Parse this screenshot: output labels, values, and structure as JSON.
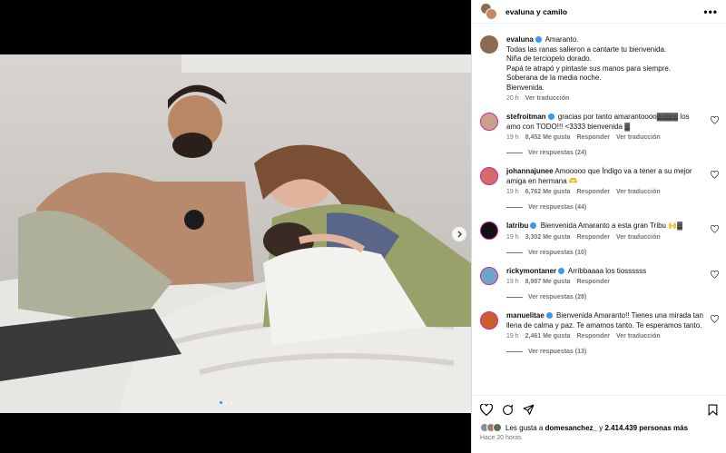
{
  "post": {
    "author": "evaluna y camilo",
    "more_label": "•••"
  },
  "caption": {
    "username": "evaluna",
    "lines": [
      "Amaranto.",
      "Todas las ranas salieron a cantarte tu bienvenida.",
      "Niña de terciopelo dorado.",
      "Papá te atrapó y pintaste sus manos para siempre.",
      "Soberana de la media noche.",
      "Bienvenida."
    ],
    "time": "20 h",
    "translate": "Ver traducción"
  },
  "comments": [
    {
      "username": "stefroitman",
      "text": "gracias por tanto amarantoooo▓▓▓▓ los amo con TODO!!! <3333 bienvenida ▓",
      "time": "19 h",
      "likes": "8,452 Me gusta",
      "reply": "Responder",
      "translate": "Ver traducción",
      "replies": "Ver respuestas (24)",
      "avatar_color": "#c9a08a",
      "verified": true
    },
    {
      "username": "johannajunee",
      "text": "Amooooo que Índigo va a tener a su mejor amiga en hermana 🫶",
      "time": "19 h",
      "likes": "6,762 Me gusta",
      "reply": "Responder",
      "translate": "Ver traducción",
      "replies": "Ver respuestas (44)",
      "avatar_color": "#d46a6a",
      "verified": false
    },
    {
      "username": "latribu",
      "text": "Bienvenida Amaranto a esta gran Tribu 🙌▓",
      "time": "19 h",
      "likes": "3,302 Me gusta",
      "reply": "Responder",
      "translate": "Ver traducción",
      "replies": "Ver respuestas (10)",
      "avatar_color": "#111111",
      "verified": true
    },
    {
      "username": "rickymontaner",
      "text": "Arribbaaaa los tiossssss",
      "time": "19 h",
      "likes": "8,987 Me gusta",
      "reply": "Responder",
      "translate": "",
      "replies": "Ver respuestas (28)",
      "avatar_color": "#6aa7c9",
      "verified": true
    },
    {
      "username": "manuelitae",
      "text": "Bienvenida Amaranto!! Tienes una mirada tan llena de calma y paz. Te amamos tanto. Te esperamos tanto.",
      "time": "19 h",
      "likes": "2,461 Me gusta",
      "reply": "Responder",
      "translate": "Ver traducción",
      "replies": "Ver respuestas (13)",
      "avatar_color": "#c8602e",
      "verified": true
    }
  ],
  "footer": {
    "likes_prefix": "Les gusta a",
    "liked_by": "domesanchez_",
    "likes_mid": "y",
    "likes_count": "2.414.439 personas más",
    "time": "Hace 20 horas"
  },
  "colors": {
    "accent": "#3897f0",
    "muted": "#737373",
    "ring": "#d6249f"
  }
}
